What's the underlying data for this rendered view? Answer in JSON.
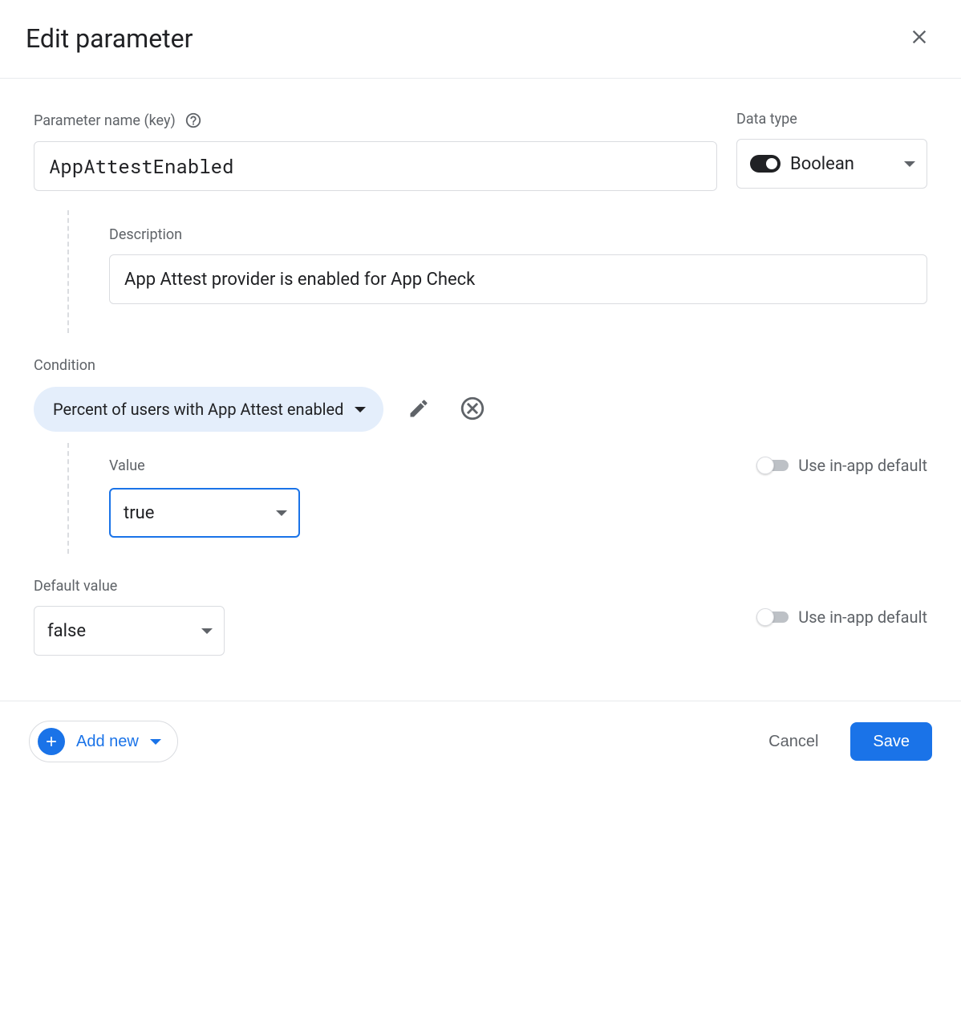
{
  "header": {
    "title": "Edit parameter"
  },
  "paramName": {
    "label": "Parameter name (key)",
    "value": "AppAttestEnabled"
  },
  "dataType": {
    "label": "Data type",
    "value": "Boolean"
  },
  "description": {
    "label": "Description",
    "value": "App Attest provider is enabled for App Check"
  },
  "condition": {
    "label": "Condition",
    "chip": "Percent of users with App Attest enabled",
    "valueLabel": "Value",
    "value": "true",
    "useDefaultLabel": "Use in-app default"
  },
  "defaultValue": {
    "label": "Default value",
    "value": "false",
    "useDefaultLabel": "Use in-app default"
  },
  "footer": {
    "addNew": "Add new",
    "cancel": "Cancel",
    "save": "Save"
  }
}
